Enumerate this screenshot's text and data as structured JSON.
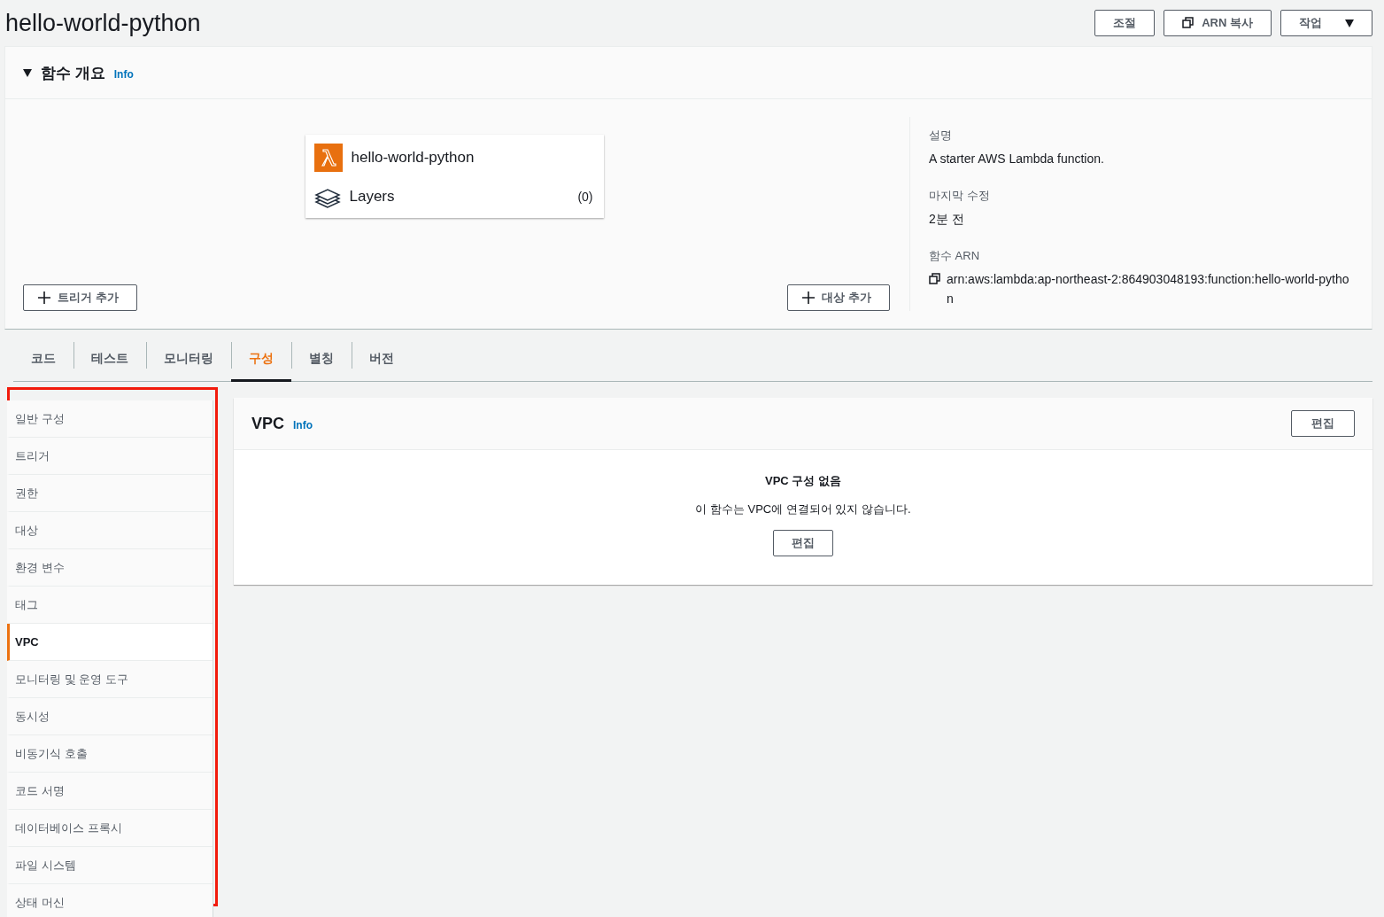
{
  "page_title": "hello-world-python",
  "header_buttons": [
    {
      "kind": "plain",
      "label": "조절"
    },
    {
      "kind": "copy",
      "label": "ARN 복사"
    },
    {
      "kind": "dropdown",
      "label": "작업"
    }
  ],
  "overview": {
    "title": "함수 개요",
    "info": "Info",
    "expanded": true,
    "function_name": "hello-world-python",
    "layers_label": "Layers",
    "layers_count": "(0)",
    "add_trigger": "트리거 추가",
    "add_destination": "대상 추가",
    "details": [
      {
        "kind": "text",
        "label": "설명",
        "value": "A starter AWS Lambda function."
      },
      {
        "kind": "text",
        "label": "마지막 수정",
        "value": "2분 전"
      },
      {
        "kind": "copy",
        "label": "함수 ARN",
        "value": "arn:aws:lambda:ap-northeast-2:864903048193:function:hello-world-python"
      }
    ]
  },
  "tabs": [
    {
      "label": "코드",
      "selected": false
    },
    {
      "label": "테스트",
      "selected": false
    },
    {
      "label": "모니터링",
      "selected": false
    },
    {
      "label": "구성",
      "selected": true
    },
    {
      "label": "별칭",
      "selected": false
    },
    {
      "label": "버전",
      "selected": false
    }
  ],
  "sidebar": {
    "items": [
      {
        "label": "일반 구성",
        "selected": false
      },
      {
        "label": "트리거",
        "selected": false
      },
      {
        "label": "권한",
        "selected": false
      },
      {
        "label": "대상",
        "selected": false
      },
      {
        "label": "환경 변수",
        "selected": false
      },
      {
        "label": "태그",
        "selected": false
      },
      {
        "label": "VPC",
        "selected": true
      },
      {
        "label": "모니터링 및 운영 도구",
        "selected": false
      },
      {
        "label": "동시성",
        "selected": false
      },
      {
        "label": "비동기식 호출",
        "selected": false
      },
      {
        "label": "코드 서명",
        "selected": false
      },
      {
        "label": "데이터베이스 프록시",
        "selected": false
      },
      {
        "label": "파일 시스템",
        "selected": false
      },
      {
        "label": "상태 머신",
        "selected": false
      }
    ]
  },
  "vpc_panel": {
    "title": "VPC",
    "info": "Info",
    "edit_button": "편집",
    "empty_title": "VPC 구성 없음",
    "empty_text": "이 함수는 VPC에 연결되어 있지 않습니다.",
    "empty_button": "편집"
  }
}
